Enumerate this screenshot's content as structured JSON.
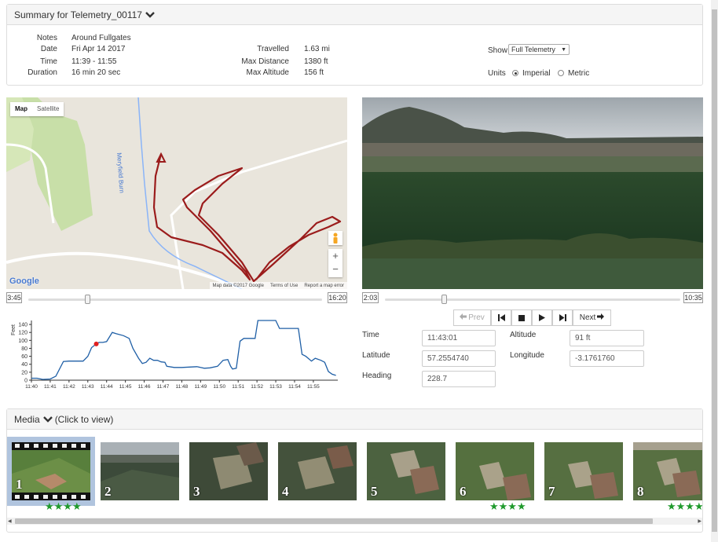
{
  "summary": {
    "title": "Summary for Telemetry_00117",
    "notes_label": "Notes",
    "notes": "Around Fullgates",
    "date_label": "Date",
    "date": "Fri Apr 14 2017",
    "time_label": "Time",
    "time": "11:39 - 11:55",
    "duration_label": "Duration",
    "duration": "16 min 20 sec",
    "travelled_label": "Travelled",
    "travelled": "1.63 mi",
    "maxdist_label": "Max Distance",
    "maxdist": "1380 ft",
    "maxalt_label": "Max Altitude",
    "maxalt": "156 ft",
    "show_label": "Show",
    "show_value": "Full Telemetry",
    "units_label": "Units",
    "imperial": "Imperial",
    "metric": "Metric"
  },
  "map": {
    "tab_map": "Map",
    "tab_satellite": "Satellite",
    "road_label": "Meryfield Burn",
    "logo": "Google",
    "attribution": "Map data ©2017 Google",
    "terms": "Terms of Use",
    "report": "Report a map error",
    "zoom_in": "+",
    "zoom_out": "−"
  },
  "map_slider": {
    "start": "3:45",
    "end": "16:20",
    "position": 0.2
  },
  "video_slider": {
    "start": "2:03",
    "end": "10:35",
    "position": 0.2
  },
  "chart_data": {
    "type": "line",
    "ylabel": "Feet",
    "yticks": [
      0,
      20,
      40,
      60,
      80,
      100,
      120,
      140
    ],
    "ylim": [
      0,
      150
    ],
    "xticks": [
      "11:40",
      "11:41",
      "11:42",
      "11:43",
      "11:44",
      "11:45",
      "11:46",
      "11:47",
      "11:48",
      "11:49",
      "11:50",
      "11:51",
      "11:52",
      "11:53",
      "11:54",
      "11:55"
    ],
    "xlim": [
      0,
      16.3
    ],
    "points": [
      [
        0,
        5
      ],
      [
        0.3,
        5
      ],
      [
        0.6,
        2
      ],
      [
        1.0,
        3
      ],
      [
        1.3,
        10
      ],
      [
        1.7,
        47
      ],
      [
        2.0,
        48
      ],
      [
        2.4,
        48
      ],
      [
        2.75,
        48
      ],
      [
        3.0,
        60
      ],
      [
        3.2,
        82
      ],
      [
        3.45,
        91
      ],
      [
        3.6,
        95
      ],
      [
        3.8,
        95
      ],
      [
        4.0,
        97
      ],
      [
        4.3,
        120
      ],
      [
        4.5,
        117
      ],
      [
        4.9,
        112
      ],
      [
        5.2,
        105
      ],
      [
        5.4,
        80
      ],
      [
        5.7,
        55
      ],
      [
        5.9,
        42
      ],
      [
        6.1,
        45
      ],
      [
        6.3,
        55
      ],
      [
        6.5,
        50
      ],
      [
        6.7,
        50
      ],
      [
        6.9,
        46
      ],
      [
        7.1,
        45
      ],
      [
        7.2,
        35
      ],
      [
        7.6,
        32
      ],
      [
        8.0,
        32
      ],
      [
        8.4,
        33
      ],
      [
        8.8,
        34
      ],
      [
        9.2,
        30
      ],
      [
        9.5,
        31
      ],
      [
        9.9,
        35
      ],
      [
        10.2,
        50
      ],
      [
        10.45,
        52
      ],
      [
        10.6,
        35
      ],
      [
        10.7,
        28
      ],
      [
        10.9,
        30
      ],
      [
        11.1,
        98
      ],
      [
        11.3,
        105
      ],
      [
        11.6,
        105
      ],
      [
        11.9,
        105
      ],
      [
        12.05,
        150
      ],
      [
        12.3,
        150
      ],
      [
        12.6,
        150
      ],
      [
        13.0,
        150
      ],
      [
        13.2,
        130
      ],
      [
        13.4,
        130
      ],
      [
        13.7,
        130
      ],
      [
        14.0,
        130
      ],
      [
        14.2,
        130
      ],
      [
        14.4,
        65
      ],
      [
        14.6,
        60
      ],
      [
        14.9,
        48
      ],
      [
        15.1,
        55
      ],
      [
        15.4,
        50
      ],
      [
        15.6,
        45
      ],
      [
        15.8,
        22
      ],
      [
        16.0,
        15
      ],
      [
        16.2,
        12
      ]
    ],
    "marker": [
      3.45,
      91
    ],
    "line_color": "#1f5fa6",
    "marker_color": "#e02020"
  },
  "controls": {
    "prev": "Prev",
    "next": "Next"
  },
  "telemetry": {
    "time_label": "Time",
    "time": "11:43:01",
    "altitude_label": "Altitude",
    "altitude": "91 ft",
    "latitude_label": "Latitude",
    "latitude": "57.2554740",
    "longitude_label": "Longitude",
    "longitude": "-3.1761760",
    "heading_label": "Heading",
    "heading": "228.7"
  },
  "media": {
    "title": "Media",
    "hint": "(Click to view)",
    "items": [
      {
        "num": "1",
        "stars": "★★★★"
      },
      {
        "num": "2",
        "stars": ""
      },
      {
        "num": "3",
        "stars": ""
      },
      {
        "num": "4",
        "stars": ""
      },
      {
        "num": "5",
        "stars": ""
      },
      {
        "num": "6",
        "stars": "★★★★"
      },
      {
        "num": "7",
        "stars": ""
      },
      {
        "num": "8",
        "stars": "★★★★"
      }
    ]
  },
  "colors": {
    "accent": "#b0c4de",
    "track": "#9b1c1c",
    "star": "#1f9a2c"
  }
}
